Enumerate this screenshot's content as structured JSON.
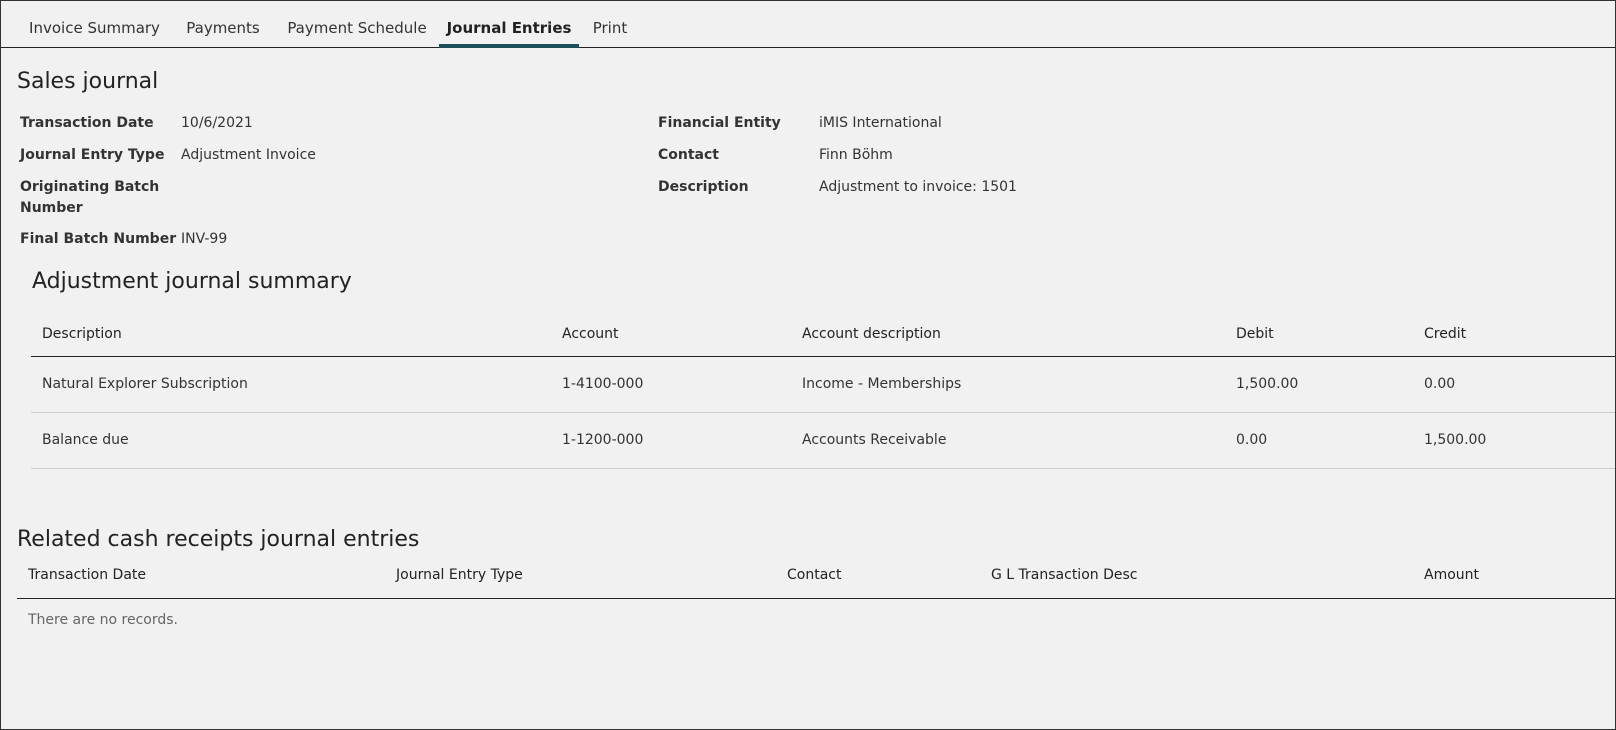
{
  "tabs": [
    "Invoice Summary",
    "Payments",
    "Payment Schedule",
    "Journal Entries",
    "Print"
  ],
  "sales_journal": {
    "heading": "Sales journal",
    "fields_left": [
      {
        "label": "Transaction Date",
        "value": "10/6/2021"
      },
      {
        "label": "Journal Entry Type",
        "value": "Adjustment Invoice"
      },
      {
        "label": "Originating Batch Number",
        "value": ""
      },
      {
        "label": "Final Batch Number",
        "value": "INV-99"
      }
    ],
    "fields_right": [
      {
        "label": "Financial Entity",
        "value": "iMIS International"
      },
      {
        "label": "Contact",
        "value": "Finn Böhm"
      },
      {
        "label": "Description",
        "value": "Adjustment to invoice: 1501"
      }
    ]
  },
  "adjustment": {
    "heading": "Adjustment journal summary",
    "columns": [
      "Description",
      "Account",
      "Account description",
      "Debit",
      "Credit"
    ],
    "rows": [
      [
        "Natural Explorer Subscription",
        "1-4100-000",
        "Income - Memberships",
        "1,500.00",
        "0.00"
      ],
      [
        "Balance due",
        "1-1200-000",
        "Accounts Receivable",
        "0.00",
        "1,500.00"
      ]
    ]
  },
  "related": {
    "heading": "Related cash receipts journal entries",
    "columns": [
      "Transaction Date",
      "Journal Entry Type",
      "Contact",
      "G L Transaction Desc",
      "Amount"
    ],
    "empty_text": "There are no records."
  }
}
